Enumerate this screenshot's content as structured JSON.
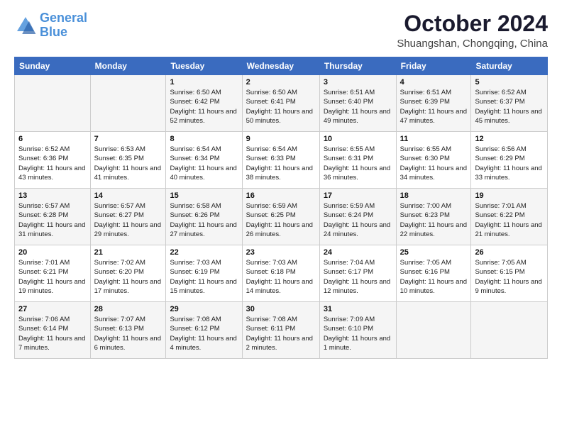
{
  "logo": {
    "line1": "General",
    "line2": "Blue"
  },
  "title": "October 2024",
  "subtitle": "Shuangshan, Chongqing, China",
  "days_of_week": [
    "Sunday",
    "Monday",
    "Tuesday",
    "Wednesday",
    "Thursday",
    "Friday",
    "Saturday"
  ],
  "weeks": [
    [
      {
        "day": "",
        "info": ""
      },
      {
        "day": "",
        "info": ""
      },
      {
        "day": "1",
        "info": "Sunrise: 6:50 AM\nSunset: 6:42 PM\nDaylight: 11 hours and 52 minutes."
      },
      {
        "day": "2",
        "info": "Sunrise: 6:50 AM\nSunset: 6:41 PM\nDaylight: 11 hours and 50 minutes."
      },
      {
        "day": "3",
        "info": "Sunrise: 6:51 AM\nSunset: 6:40 PM\nDaylight: 11 hours and 49 minutes."
      },
      {
        "day": "4",
        "info": "Sunrise: 6:51 AM\nSunset: 6:39 PM\nDaylight: 11 hours and 47 minutes."
      },
      {
        "day": "5",
        "info": "Sunrise: 6:52 AM\nSunset: 6:37 PM\nDaylight: 11 hours and 45 minutes."
      }
    ],
    [
      {
        "day": "6",
        "info": "Sunrise: 6:52 AM\nSunset: 6:36 PM\nDaylight: 11 hours and 43 minutes."
      },
      {
        "day": "7",
        "info": "Sunrise: 6:53 AM\nSunset: 6:35 PM\nDaylight: 11 hours and 41 minutes."
      },
      {
        "day": "8",
        "info": "Sunrise: 6:54 AM\nSunset: 6:34 PM\nDaylight: 11 hours and 40 minutes."
      },
      {
        "day": "9",
        "info": "Sunrise: 6:54 AM\nSunset: 6:33 PM\nDaylight: 11 hours and 38 minutes."
      },
      {
        "day": "10",
        "info": "Sunrise: 6:55 AM\nSunset: 6:31 PM\nDaylight: 11 hours and 36 minutes."
      },
      {
        "day": "11",
        "info": "Sunrise: 6:55 AM\nSunset: 6:30 PM\nDaylight: 11 hours and 34 minutes."
      },
      {
        "day": "12",
        "info": "Sunrise: 6:56 AM\nSunset: 6:29 PM\nDaylight: 11 hours and 33 minutes."
      }
    ],
    [
      {
        "day": "13",
        "info": "Sunrise: 6:57 AM\nSunset: 6:28 PM\nDaylight: 11 hours and 31 minutes."
      },
      {
        "day": "14",
        "info": "Sunrise: 6:57 AM\nSunset: 6:27 PM\nDaylight: 11 hours and 29 minutes."
      },
      {
        "day": "15",
        "info": "Sunrise: 6:58 AM\nSunset: 6:26 PM\nDaylight: 11 hours and 27 minutes."
      },
      {
        "day": "16",
        "info": "Sunrise: 6:59 AM\nSunset: 6:25 PM\nDaylight: 11 hours and 26 minutes."
      },
      {
        "day": "17",
        "info": "Sunrise: 6:59 AM\nSunset: 6:24 PM\nDaylight: 11 hours and 24 minutes."
      },
      {
        "day": "18",
        "info": "Sunrise: 7:00 AM\nSunset: 6:23 PM\nDaylight: 11 hours and 22 minutes."
      },
      {
        "day": "19",
        "info": "Sunrise: 7:01 AM\nSunset: 6:22 PM\nDaylight: 11 hours and 21 minutes."
      }
    ],
    [
      {
        "day": "20",
        "info": "Sunrise: 7:01 AM\nSunset: 6:21 PM\nDaylight: 11 hours and 19 minutes."
      },
      {
        "day": "21",
        "info": "Sunrise: 7:02 AM\nSunset: 6:20 PM\nDaylight: 11 hours and 17 minutes."
      },
      {
        "day": "22",
        "info": "Sunrise: 7:03 AM\nSunset: 6:19 PM\nDaylight: 11 hours and 15 minutes."
      },
      {
        "day": "23",
        "info": "Sunrise: 7:03 AM\nSunset: 6:18 PM\nDaylight: 11 hours and 14 minutes."
      },
      {
        "day": "24",
        "info": "Sunrise: 7:04 AM\nSunset: 6:17 PM\nDaylight: 11 hours and 12 minutes."
      },
      {
        "day": "25",
        "info": "Sunrise: 7:05 AM\nSunset: 6:16 PM\nDaylight: 11 hours and 10 minutes."
      },
      {
        "day": "26",
        "info": "Sunrise: 7:05 AM\nSunset: 6:15 PM\nDaylight: 11 hours and 9 minutes."
      }
    ],
    [
      {
        "day": "27",
        "info": "Sunrise: 7:06 AM\nSunset: 6:14 PM\nDaylight: 11 hours and 7 minutes."
      },
      {
        "day": "28",
        "info": "Sunrise: 7:07 AM\nSunset: 6:13 PM\nDaylight: 11 hours and 6 minutes."
      },
      {
        "day": "29",
        "info": "Sunrise: 7:08 AM\nSunset: 6:12 PM\nDaylight: 11 hours and 4 minutes."
      },
      {
        "day": "30",
        "info": "Sunrise: 7:08 AM\nSunset: 6:11 PM\nDaylight: 11 hours and 2 minutes."
      },
      {
        "day": "31",
        "info": "Sunrise: 7:09 AM\nSunset: 6:10 PM\nDaylight: 11 hours and 1 minute."
      },
      {
        "day": "",
        "info": ""
      },
      {
        "day": "",
        "info": ""
      }
    ]
  ]
}
